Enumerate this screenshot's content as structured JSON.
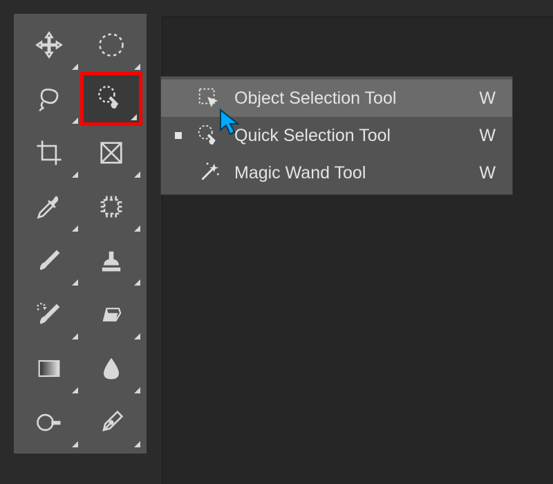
{
  "toolbar": {
    "tools": [
      {
        "name": "move-tool"
      },
      {
        "name": "marquee-tool"
      },
      {
        "name": "lasso-tool"
      },
      {
        "name": "quick-selection-tool",
        "highlighted": true
      },
      {
        "name": "crop-tool"
      },
      {
        "name": "frame-tool"
      },
      {
        "name": "eyedropper-tool"
      },
      {
        "name": "slice-tool"
      },
      {
        "name": "brush-tool"
      },
      {
        "name": "clone-stamp-tool"
      },
      {
        "name": "history-brush-tool"
      },
      {
        "name": "eraser-tool"
      },
      {
        "name": "gradient-tool"
      },
      {
        "name": "blur-tool"
      },
      {
        "name": "dodge-tool"
      },
      {
        "name": "pen-tool"
      }
    ]
  },
  "flyout": {
    "items": [
      {
        "label": "Object Selection Tool",
        "shortcut": "W",
        "hovered": true,
        "active": false,
        "icon": "object-selection-icon"
      },
      {
        "label": "Quick Selection Tool",
        "shortcut": "W",
        "hovered": false,
        "active": true,
        "icon": "quick-selection-icon"
      },
      {
        "label": "Magic Wand Tool",
        "shortcut": "W",
        "hovered": false,
        "active": false,
        "icon": "magic-wand-icon"
      }
    ]
  },
  "colors": {
    "highlight_border": "#ff0000",
    "cursor": "#00aaff"
  }
}
